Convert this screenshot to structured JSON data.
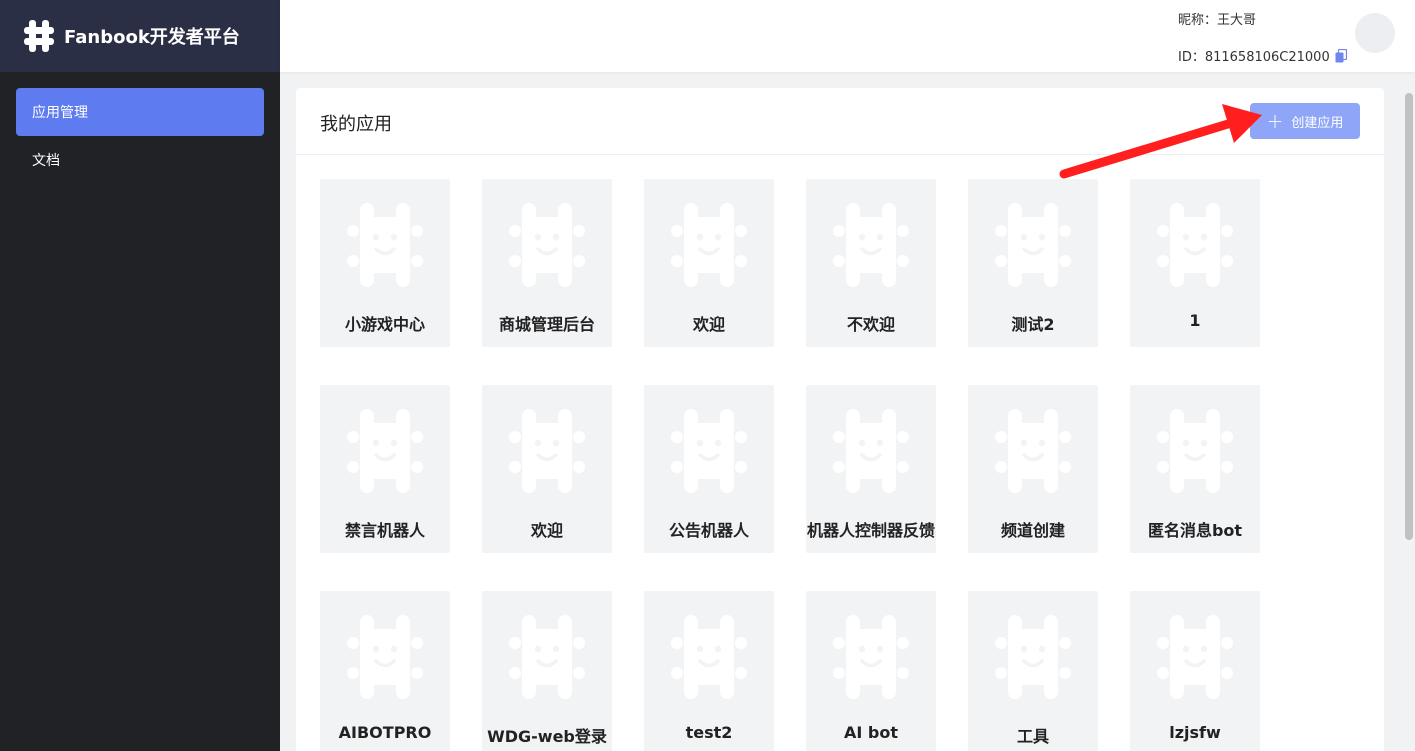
{
  "brand": {
    "title": "Fanbook开发者平台"
  },
  "sidebar": {
    "items": [
      {
        "label": "应用管理",
        "active": true
      },
      {
        "label": "文档",
        "active": false
      }
    ]
  },
  "header": {
    "nickname": "昵称：王大哥",
    "id_label": "ID：811658106C21000"
  },
  "main": {
    "title": "我的应用",
    "create_button": "创建应用",
    "apps": [
      {
        "name": "小游戏中心"
      },
      {
        "name": "商城管理后台"
      },
      {
        "name": "欢迎"
      },
      {
        "name": "不欢迎"
      },
      {
        "name": "测试2"
      },
      {
        "name": "1"
      },
      {
        "name": "禁言机器人"
      },
      {
        "name": "欢迎"
      },
      {
        "name": "公告机器人"
      },
      {
        "name": "机器人控制器反馈"
      },
      {
        "name": "频道创建"
      },
      {
        "name": "匿名消息bot"
      },
      {
        "name": "AIBOTPRO"
      },
      {
        "name": "WDG-web登录"
      },
      {
        "name": "test2"
      },
      {
        "name": "AI bot"
      },
      {
        "name": "工具"
      },
      {
        "name": "lzjsfw"
      }
    ]
  },
  "colors": {
    "sidebar_bg": "#202226",
    "brand_bg": "#2b2f45",
    "accent": "#5e7bef",
    "create_button": "#8fa5f8",
    "annotation_arrow": "#ff1f1f"
  }
}
